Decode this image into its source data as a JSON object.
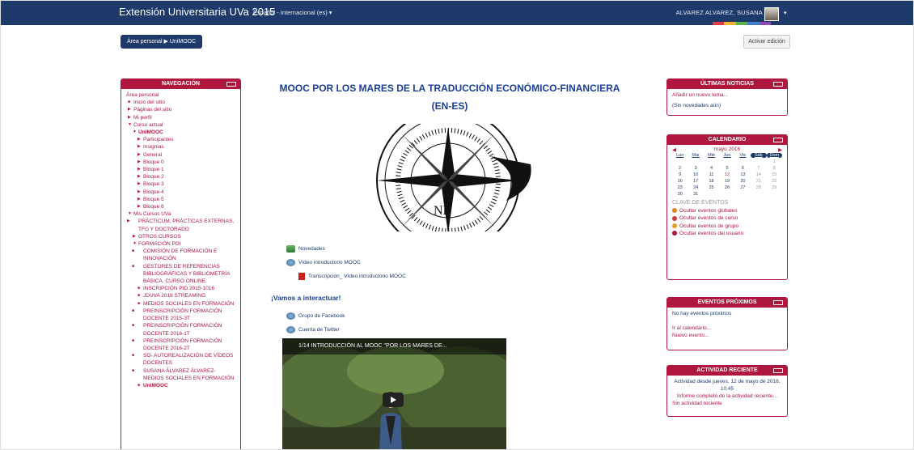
{
  "navbar": {
    "brand": "Extensión Universitaria UVa 2015",
    "language": "Español - Internacional (es) ▾",
    "user": "ALVAREZ ALVAREZ, SUSANA",
    "caret": "▾"
  },
  "breadcrumb": "Área personal ▶ UniMOOC",
  "edit_button": "Activar edición",
  "navigation": {
    "title": "NAVEGACIÓN",
    "items": [
      {
        "text": "Área personal",
        "mark": "",
        "indent": 0
      },
      {
        "text": "Inicio del sitio",
        "mark": "■",
        "indent": 1
      },
      {
        "text": "Páginas del sitio",
        "mark": "▶",
        "indent": 1
      },
      {
        "text": "Mi perfil",
        "mark": "▶",
        "indent": 1
      },
      {
        "text": "Curso actual",
        "mark": "▼",
        "indent": 1
      },
      {
        "text": "UniMOOC",
        "mark": "▼",
        "indent": 2,
        "bold": true
      },
      {
        "text": "Participantes",
        "mark": "▶",
        "indent": 3
      },
      {
        "text": "Insignias",
        "mark": "▶",
        "indent": 3
      },
      {
        "text": "General",
        "mark": "▶",
        "indent": 3
      },
      {
        "text": "Bloque 0",
        "mark": "▶",
        "indent": 3
      },
      {
        "text": "Bloque 1",
        "mark": "▶",
        "indent": 3
      },
      {
        "text": "Bloque 2",
        "mark": "▶",
        "indent": 3
      },
      {
        "text": "Bloque 3",
        "mark": "▶",
        "indent": 3
      },
      {
        "text": "Bloque 4",
        "mark": "▶",
        "indent": 3
      },
      {
        "text": "Bloque 5",
        "mark": "▶",
        "indent": 3
      },
      {
        "text": "Bloque 6",
        "mark": "▶",
        "indent": 3
      },
      {
        "text": "Mis Cursos UVa",
        "mark": "▼",
        "indent": 1
      },
      {
        "text": "PRÁCTICUM, PRÁCTICAS EXTERNAS, TFG Y DOCTORADO",
        "mark": "▶",
        "indent": 2
      },
      {
        "text": "OTROS CURSOS",
        "mark": "▶",
        "indent": 2
      },
      {
        "text": "FORMACIÓN PDI",
        "mark": "▼",
        "indent": 2
      },
      {
        "text": "COMISIÓN DE FORMACIÓN E INNOVACIÓN",
        "mark": "■",
        "indent": 3
      },
      {
        "text": "GESTORES DE REFERENCIAS BIBLIOGRÁFICAS Y BIBLIOMETRÍA BÁSICA. CURSO ONLINE.",
        "mark": "■",
        "indent": 3
      },
      {
        "text": "INSCRIPCIÓN PID 2015-1016",
        "mark": "■",
        "indent": 3
      },
      {
        "text": "JDUVA 2016 STREAMING",
        "mark": "■",
        "indent": 3
      },
      {
        "text": "MEDIOS SOCIALES EN FORMACIÓN",
        "mark": "■",
        "indent": 3
      },
      {
        "text": "PREINSCRIPCIÓN FORMACIÓN DOCENTE 2015-3T",
        "mark": "■",
        "indent": 3
      },
      {
        "text": "PREINSCRIPCIÓN FORMACIÓN DOCENTE 2016-1T",
        "mark": "■",
        "indent": 3
      },
      {
        "text": "PREINSCRIPCIÓN FORMACIÓN DOCENTE 2016-2T",
        "mark": "■",
        "indent": 3
      },
      {
        "text": "SO- AUTOREALIZACIÓN DE VÍDEOS DOCENTES",
        "mark": "■",
        "indent": 3
      },
      {
        "text": "SUSANA ÁLVAREZ ÁLVAREZ- MEDIOS SOCIALES EN FORMACIÓN",
        "mark": "■",
        "indent": 3
      },
      {
        "text": "UniMOOC",
        "mark": "■",
        "indent": 3,
        "bold": true
      }
    ]
  },
  "course": {
    "title_line1": "MOOC POR LOS MARES DE LA TRADUCCIÓN ECONÓMICO-FINANCIERA",
    "title_line2": "(EN-ES)",
    "activities": [
      {
        "name": "forum-link",
        "text": "Novedades",
        "icon": "forum-icon"
      },
      {
        "name": "intro-video-link",
        "text": "Vídeo introductorio MOOC",
        "icon": "url-icon"
      },
      {
        "name": "transcript-link",
        "text": "Transcripción_ Vídeo introductorio MOOC",
        "icon": "pdf-icon"
      }
    ],
    "section_title": "¡Vamos a interactuar!",
    "social": [
      {
        "name": "facebook-group-link",
        "text": "Grupo de Facebook",
        "icon": "url-icon"
      },
      {
        "name": "twitter-account-link",
        "text": "Cuenta de Twitter",
        "icon": "url-icon"
      }
    ],
    "video_title": "1/14  INTRODUCCIÓN AL MOOC \"POR LOS MARES DE...",
    "compass_label": "NE"
  },
  "news": {
    "title": "ÚLTIMAS NOTICIAS",
    "add": "Añadir un nuevo tema...",
    "empty": "(Sin novedades aún)"
  },
  "calendar": {
    "title": "CALENDARIO",
    "month": "mayo 2016",
    "prev": "◀",
    "next": "▶",
    "weekdays": [
      "Lun",
      "Mar",
      "Mié",
      "Jue",
      "Vie",
      "Sáb",
      "Dom"
    ],
    "weeks": [
      [
        "",
        "",
        "",
        "",
        "",
        "",
        "1"
      ],
      [
        "2",
        "3",
        "4",
        "5",
        "6",
        "7",
        "8"
      ],
      [
        "9",
        "10",
        "11",
        "12",
        "13",
        "14",
        "15"
      ],
      [
        "16",
        "17",
        "18",
        "19",
        "20",
        "21",
        "22"
      ],
      [
        "23",
        "24",
        "25",
        "26",
        "27",
        "28",
        "29"
      ],
      [
        "30",
        "31",
        "",
        "",
        "",
        "",
        ""
      ]
    ],
    "today": "12",
    "key_title": "CLAVE DE EVENTOS",
    "events": [
      {
        "text": "Ocultar eventos globales",
        "color": "#d98a1f"
      },
      {
        "text": "Ocultar eventos de curso",
        "color": "#c43c3c"
      },
      {
        "text": "Ocultar eventos de grupo",
        "color": "#e0a020"
      },
      {
        "text": "Ocultar eventos del usuario",
        "color": "#a01a3a"
      }
    ]
  },
  "upcoming": {
    "title": "EVENTOS PRÓXIMOS",
    "none": "No hay eventos próximos",
    "go_calendar": "Ir al calendario...",
    "new_event": "Nuevo evento..."
  },
  "recent": {
    "title": "ACTIVIDAD RECIENTE",
    "since": "Actividad desde jueves, 12 de mayo de 2016, 10:45",
    "report": "Informe completo de la actividad reciente...",
    "none": "Sin actividad reciente"
  },
  "colors": {
    "navbar": "#1d3a6b",
    "block": "#b0173f",
    "title": "#1b3d96",
    "strip": [
      "#e23b47",
      "#f2b233",
      "#5bb24a",
      "#3f7dd1",
      "#8c4bb7"
    ]
  }
}
